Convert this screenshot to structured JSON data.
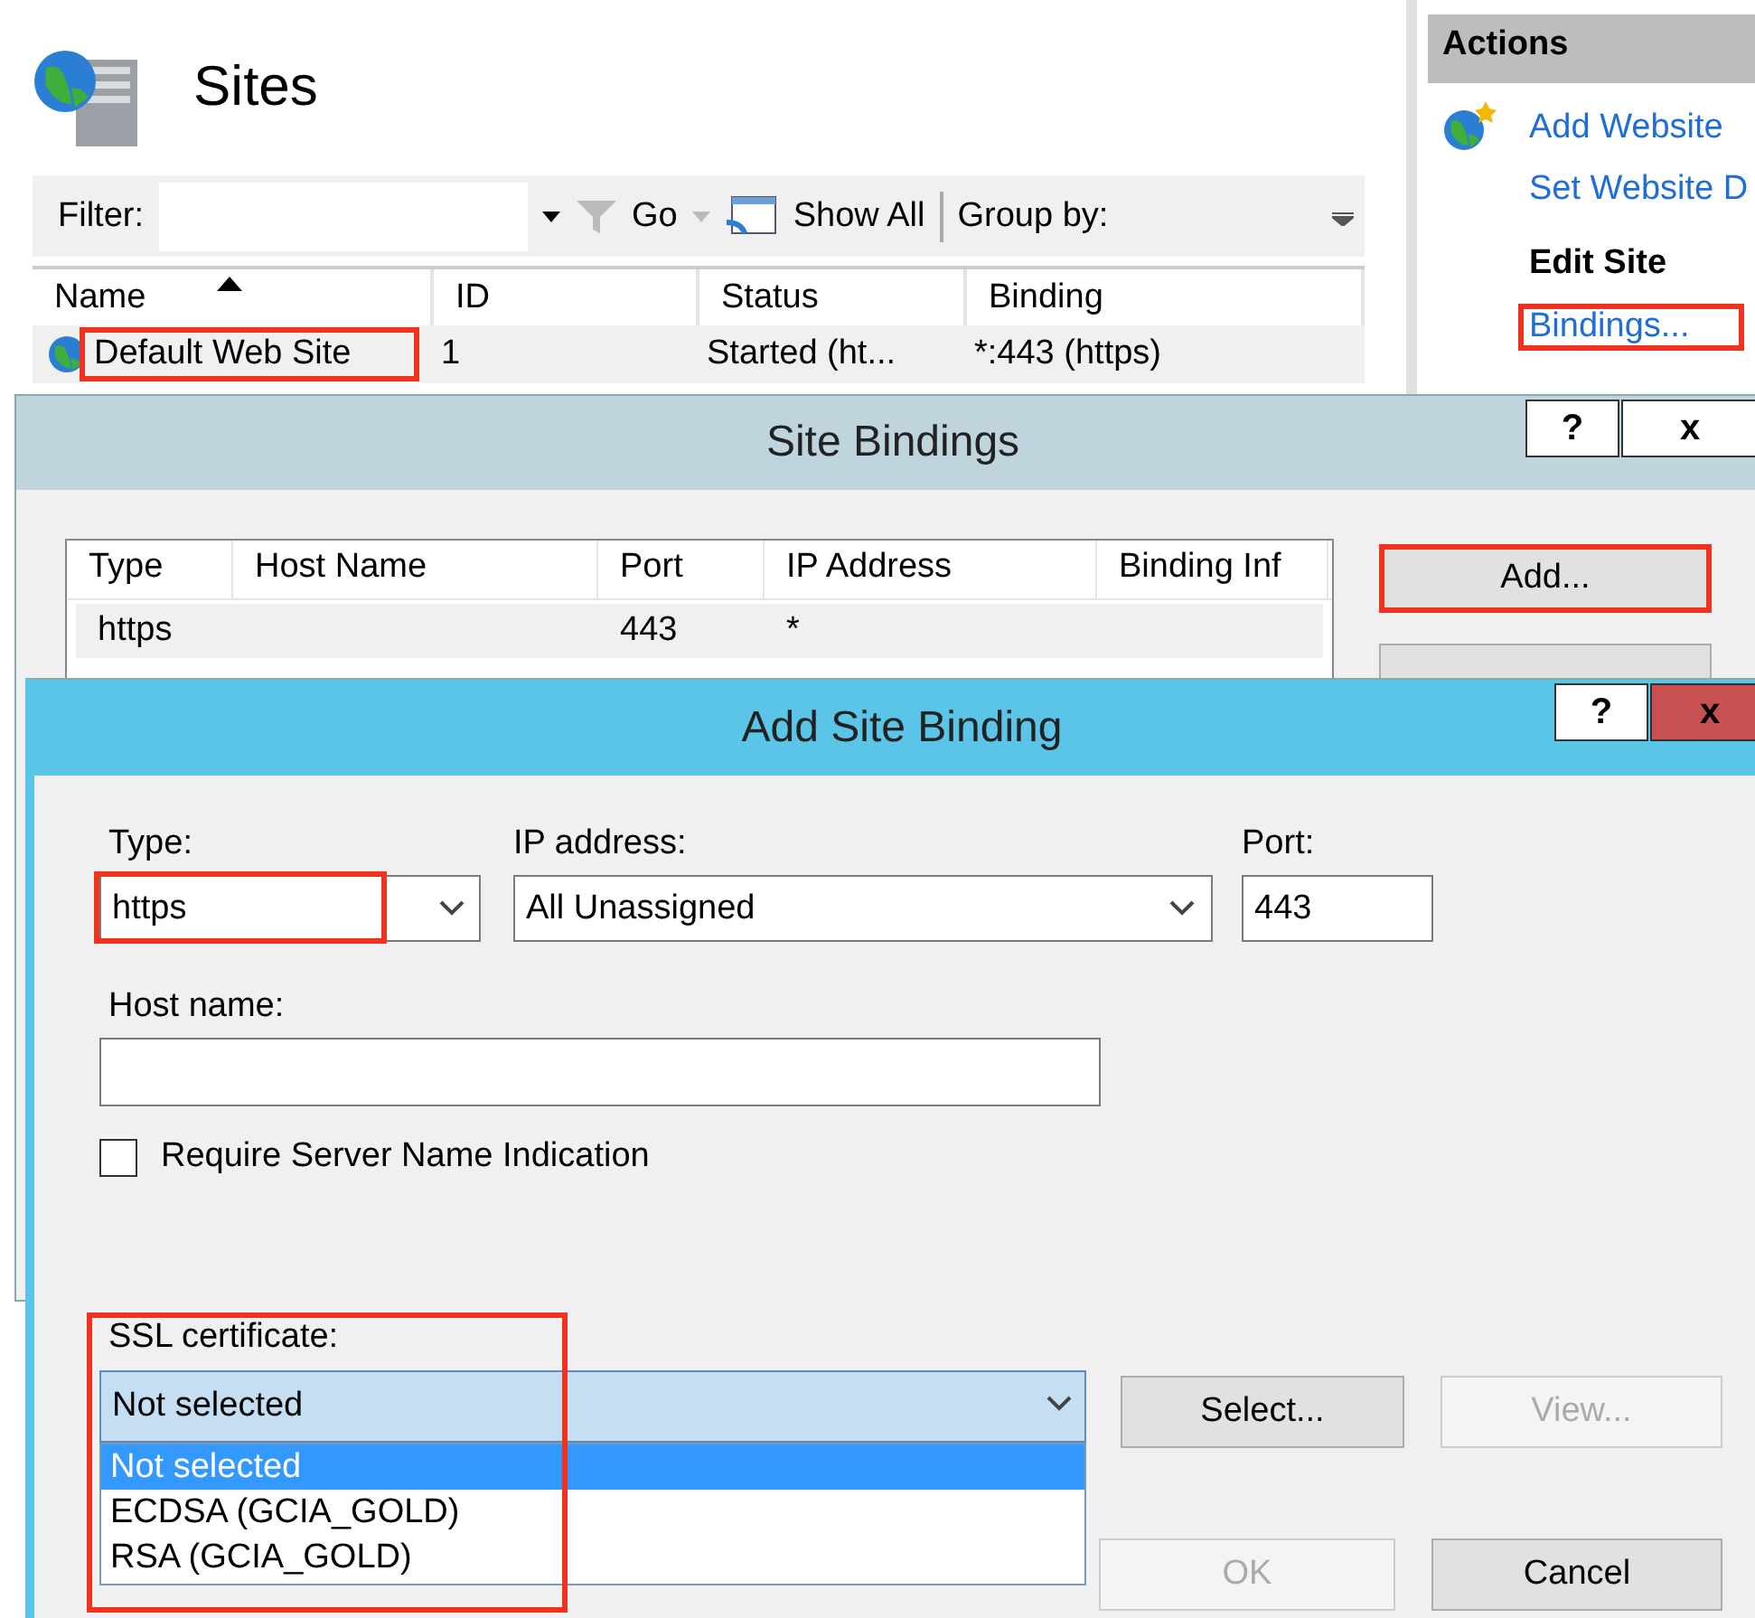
{
  "sites_page": {
    "title": "Sites",
    "toolbar": {
      "filter_label": "Filter:",
      "go": "Go",
      "show_all": "Show All",
      "group_by": "Group by:"
    },
    "columns": [
      {
        "label": "Name",
        "sorted": true
      },
      {
        "label": "ID",
        "sorted": false
      },
      {
        "label": "Status",
        "sorted": false
      },
      {
        "label": "Binding",
        "sorted": false
      }
    ],
    "rows": [
      {
        "name": "Default Web Site",
        "id": "1",
        "status": "Started (ht...",
        "binding": "*:443 (https)",
        "highlighted": true
      }
    ]
  },
  "actions": {
    "title": "Actions",
    "items": [
      {
        "kind": "link",
        "label": "Add Website",
        "highlighted": false
      },
      {
        "kind": "link",
        "label": "Set Website D",
        "highlighted": false
      },
      {
        "kind": "heading",
        "label": "Edit Site",
        "highlighted": false
      },
      {
        "kind": "link",
        "label": "Bindings...",
        "highlighted": true
      }
    ]
  },
  "site_bindings": {
    "title": "Site Bindings",
    "help": "?",
    "close": "x",
    "columns": [
      "Type",
      "Host Name",
      "Port",
      "IP Address",
      "Binding Inf"
    ],
    "rows": [
      {
        "type": "https",
        "port": "443",
        "ip_address": "*"
      }
    ],
    "buttons": [
      {
        "label": "Add...",
        "highlighted": true
      }
    ]
  },
  "add_site_binding": {
    "title": "Add Site Binding",
    "help": "?",
    "close": "x",
    "type": {
      "label": "Type:",
      "value": "https",
      "highlighted": true
    },
    "ip_address": {
      "label": "IP address:",
      "value": "All Unassigned"
    },
    "port": {
      "label": "Port:",
      "value": "443"
    },
    "host_name": {
      "label": "Host name:"
    },
    "sni": {
      "label": "Require Server Name Indication",
      "checked": false
    },
    "ssl_certificate": {
      "label": "SSL certificate:",
      "value": "Not selected",
      "highlighted": true,
      "options": [
        {
          "label": "Not selected",
          "selected": true
        },
        {
          "label": "ECDSA (GCIA_GOLD)",
          "selected": false
        },
        {
          "label": "RSA (GCIA_GOLD)",
          "selected": false
        }
      ]
    },
    "buttons": [
      {
        "label": "Select...",
        "disabled": false
      },
      {
        "label": "View...",
        "disabled": true
      },
      {
        "label": "OK",
        "disabled": true
      },
      {
        "label": "Cancel",
        "disabled": false
      }
    ]
  }
}
